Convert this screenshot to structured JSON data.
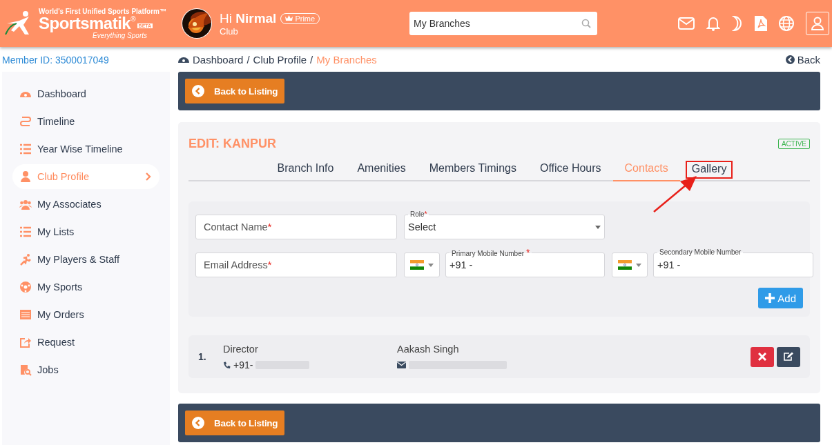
{
  "header": {
    "tagline": "World's First Unified Sports Platform™",
    "brand": "Sportsmatik",
    "brand_mark": "®",
    "beta": "BETA",
    "slogan": "Everything Sports",
    "greeting": "Hi",
    "user_name": "Nirmal",
    "badge": "Prime",
    "user_role": "Club",
    "search": {
      "value": "My Branches"
    }
  },
  "member_id": "Member ID: 3500017049",
  "breadcrumb": [
    {
      "kind": "link",
      "label": "Dashboard",
      "current": false
    },
    {
      "kind": "separator",
      "label": "/"
    },
    {
      "kind": "link",
      "label": "Club Profile",
      "current": false
    },
    {
      "kind": "separator",
      "label": "/"
    },
    {
      "kind": "link",
      "label": "My Branches",
      "current": true
    }
  ],
  "back": "Back",
  "sidebar": {
    "items": [
      {
        "label": "Dashboard",
        "selected": false
      },
      {
        "label": "Timeline",
        "selected": false
      },
      {
        "label": "Year Wise Timeline",
        "selected": false
      },
      {
        "label": "Club Profile",
        "selected": true
      },
      {
        "label": "My Associates",
        "selected": false
      },
      {
        "label": "My Lists",
        "selected": false
      },
      {
        "label": "My Players & Staff",
        "selected": false
      },
      {
        "label": "My Sports",
        "selected": false
      },
      {
        "label": "My Orders",
        "selected": false
      },
      {
        "label": "Request",
        "selected": false
      },
      {
        "label": "Jobs",
        "selected": false
      }
    ]
  },
  "top_bar": {
    "button": "Back to Listing"
  },
  "panel": {
    "title": "EDIT: KANPUR",
    "status": "ACTIVE",
    "tabs": [
      {
        "label": "Branch Info",
        "selected": false,
        "highlighted": false
      },
      {
        "label": "Amenities",
        "selected": false,
        "highlighted": false
      },
      {
        "label": "Members Timings",
        "selected": false,
        "highlighted": false
      },
      {
        "label": "Office Hours",
        "selected": false,
        "highlighted": false
      },
      {
        "label": "Contacts",
        "selected": true,
        "highlighted": false
      },
      {
        "label": "Gallery",
        "selected": false,
        "highlighted": true
      }
    ]
  },
  "form": {
    "contact_name": {
      "placeholder": "Contact Name",
      "required_mark": "*"
    },
    "role": {
      "label": "Role",
      "required_mark": "*",
      "value": "Select"
    },
    "email": {
      "placeholder": "Email Address",
      "required_mark": "*"
    },
    "primary_mobile": {
      "label": "Primary Mobile Number",
      "required_mark": "*",
      "value": "+91 -"
    },
    "secondary_mobile": {
      "label": "Secondary Mobile Number",
      "value": "+91 -"
    },
    "add_button": "Add"
  },
  "contacts": [
    {
      "number": "1.",
      "role": "Director",
      "phone": "+91-",
      "name": "Aakash Singh"
    }
  ],
  "bottom_bar": {
    "button": "Back to Listing"
  }
}
